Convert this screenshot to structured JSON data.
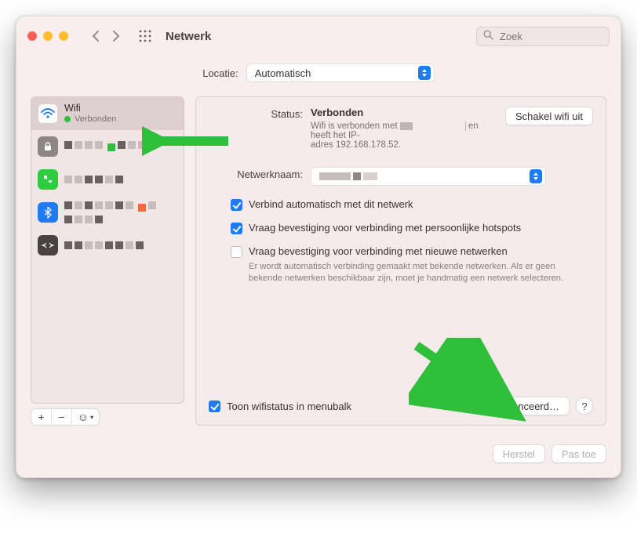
{
  "toolbar": {
    "title": "Netwerk",
    "search_placeholder": "Zoek"
  },
  "location": {
    "label": "Locatie:",
    "value": "Automatisch"
  },
  "sidebar": {
    "items": [
      {
        "name": "Wifi",
        "status": "Verbonden"
      }
    ]
  },
  "status": {
    "label": "Status:",
    "value": "Verbonden",
    "sub1": "Wifi is verbonden met",
    "sub2": "adres 192.168.178.52.",
    "sub3": "en heeft het IP-",
    "disable_label": "Schakel wifi uit"
  },
  "network_name": {
    "label": "Netwerknaam:"
  },
  "checks": {
    "auto_join": "Verbind automatisch met dit netwerk",
    "ask_hotspot": "Vraag bevestiging voor verbinding met persoonlijke hotspots",
    "ask_new": "Vraag bevestiging voor verbinding met nieuwe netwerken",
    "ask_new_hint": "Er wordt automatisch verbinding gemaakt met bekende netwerken. Als er geen bekende netwerken beschikbaar zijn, moet je handmatig een netwerk selecteren."
  },
  "footer": {
    "show_menubar": "Toon wifistatus in menubalk",
    "advanced": "Geavanceerd…",
    "help": "?",
    "revert": "Herstel",
    "apply": "Pas toe"
  }
}
